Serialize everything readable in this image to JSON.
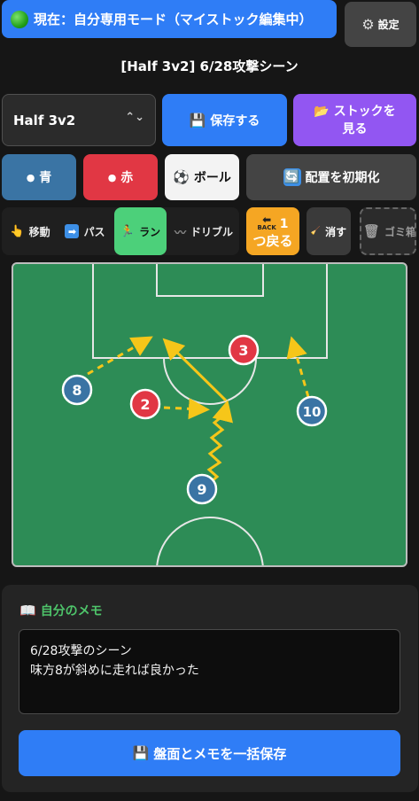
{
  "header": {
    "mode_text": "現在：自分専用モード（マイストック編集中）",
    "settings_label": "設定"
  },
  "scene": {
    "title": "[Half 3v2] 6/28攻撃シーン"
  },
  "stock": {
    "selected": "Half 3v2",
    "save_label": "保存する",
    "view_line1": "ストックを",
    "view_line2": "見る"
  },
  "teams": {
    "blue_label": "青",
    "red_label": "赤",
    "ball_label": "ボール",
    "reset_label": "配置を初期化"
  },
  "tools": {
    "move_label": "移動",
    "pass_label": "パス",
    "run_label": "ラン",
    "dribble_label": "ドリブル",
    "back_small": "BACK",
    "back_count": "1",
    "back_label": "つ戻る",
    "erase_label": "消す",
    "trash_label": "ゴミ箱"
  },
  "colors": {
    "accent_blue": "#2f7df6",
    "team_blue": "#3a74a4",
    "team_red": "#e13744",
    "run_active": "#4cd07a",
    "back_orange": "#f5a623",
    "memo_title": "#4ec46a",
    "pitch": "#2d8c56",
    "arrow": "#f6c619"
  },
  "field": {
    "players": [
      {
        "team": "blue",
        "number": "8"
      },
      {
        "team": "red",
        "number": "2"
      },
      {
        "team": "red",
        "number": "3"
      },
      {
        "team": "blue",
        "number": "10"
      },
      {
        "team": "blue",
        "number": "9"
      }
    ]
  },
  "memo": {
    "title": "自分のメモ",
    "text": "6/28攻撃のシーン\n味方8が斜めに走れば良かった",
    "save_all_label": "盤面とメモを一括保存"
  }
}
